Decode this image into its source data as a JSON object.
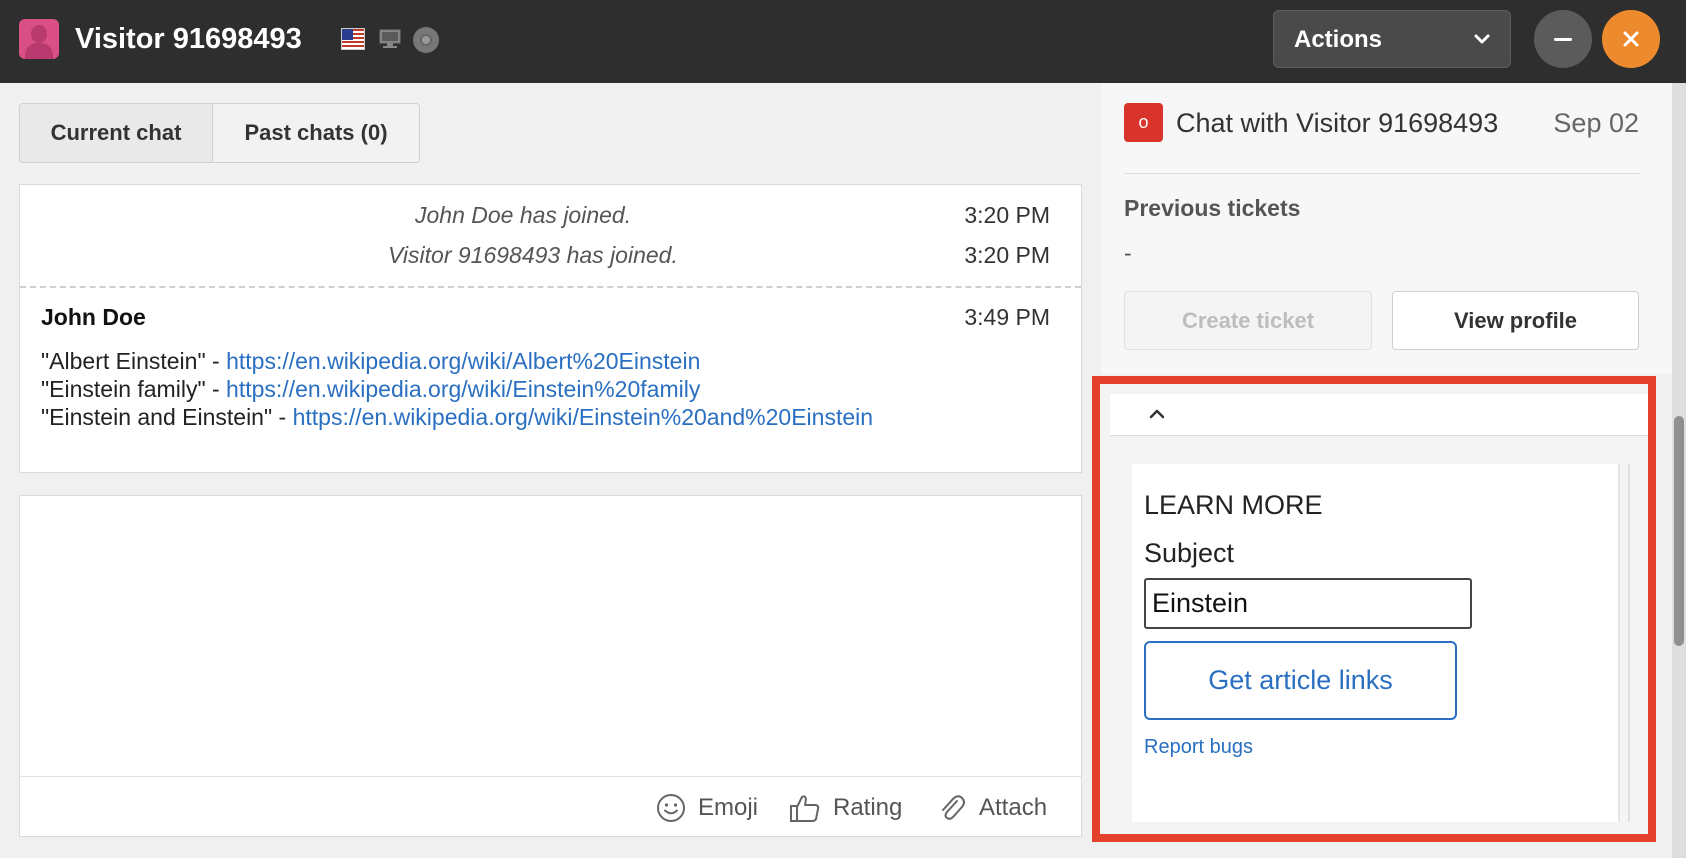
{
  "header": {
    "visitor_name": "Visitor 91698493",
    "actions_label": "Actions",
    "icons": [
      "avatar",
      "us-flag-icon",
      "monitor-icon",
      "browser-icon",
      "chevron-down-icon",
      "minimize-icon",
      "close-icon"
    ],
    "colors": {
      "bar": "#2e2e2e",
      "close": "#ee8a2e",
      "minimize": "#5b5b5b"
    }
  },
  "tabs": [
    {
      "label": "Current chat",
      "active": true
    },
    {
      "label": "Past chats (0)",
      "active": false
    }
  ],
  "chat": {
    "system_messages": [
      {
        "text": "John Doe has joined.",
        "time": "3:20 PM"
      },
      {
        "text": "Visitor 91698493 has joined.",
        "time": "3:20 PM"
      }
    ],
    "message": {
      "author": "John Doe",
      "time": "3:49 PM",
      "lines": [
        {
          "prefix": "\"Albert Einstein\" - ",
          "link": "https://en.wikipedia.org/wiki/Albert%20Einstein"
        },
        {
          "prefix": "\"Einstein family\" - ",
          "link": "https://en.wikipedia.org/wiki/Einstein%20family"
        },
        {
          "prefix": "\"Einstein and Einstein\" - ",
          "link": "https://en.wikipedia.org/wiki/Einstein%20and%20Einstein"
        }
      ]
    }
  },
  "compose": {
    "toolbar": {
      "emoji": "Emoji",
      "rating": "Rating",
      "attach": "Attach"
    }
  },
  "ticket_panel": {
    "badge": "o",
    "title": "Chat with Visitor 91698493",
    "date": "Sep 02",
    "previous_tickets_label": "Previous tickets",
    "previous_tickets_value": "-",
    "create_ticket": "Create ticket",
    "view_profile": "View profile"
  },
  "widget": {
    "heading": "LEARN MORE",
    "subject_label": "Subject",
    "subject_value": "Einstein",
    "button": "Get article links",
    "report_link": "Report bugs",
    "highlight_color": "#e4412d"
  }
}
